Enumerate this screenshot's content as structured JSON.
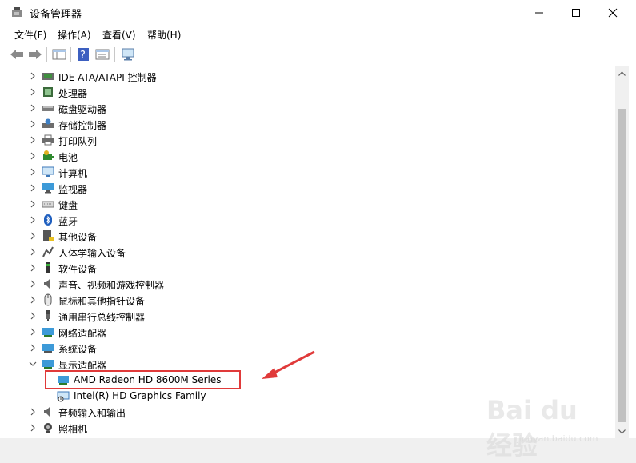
{
  "window": {
    "title": "设备管理器"
  },
  "menu": {
    "file": "文件(F)",
    "action": "操作(A)",
    "view": "查看(V)",
    "help": "帮助(H)"
  },
  "tree": {
    "categories": [
      "IDE ATA/ATAPI 控制器",
      "处理器",
      "磁盘驱动器",
      "存储控制器",
      "打印队列",
      "电池",
      "计算机",
      "监视器",
      "键盘",
      "蓝牙",
      "其他设备",
      "人体学输入设备",
      "软件设备",
      "声音、视频和游戏控制器",
      "鼠标和其他指针设备",
      "通用串行总线控制器",
      "网络适配器",
      "系统设备",
      "显示适配器",
      "音频输入和输出",
      "照相机"
    ],
    "display_children": [
      "AMD Radeon HD 8600M Series",
      "Intel(R) HD Graphics Family"
    ]
  },
  "watermark": {
    "brand": "Bai du 经验",
    "url": "jingyan.baidu.com"
  },
  "colors": {
    "highlight": "#e03a3a",
    "accent": "#1e90ff"
  }
}
